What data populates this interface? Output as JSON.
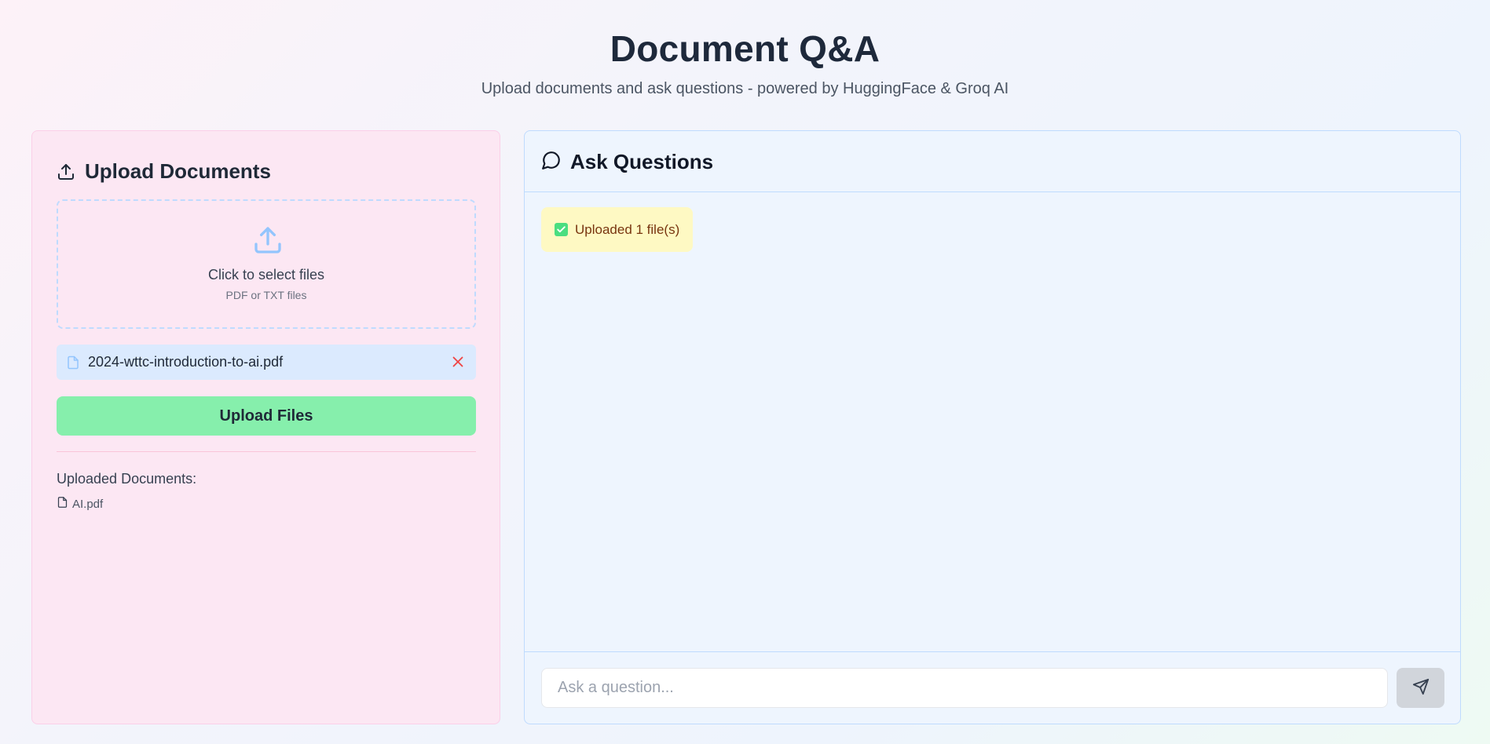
{
  "header": {
    "title": "Document Q&A",
    "subtitle": "Upload documents and ask questions - powered by HuggingFace & Groq AI"
  },
  "upload_panel": {
    "heading": "Upload Documents",
    "heading_icon": "upload-icon",
    "dropzone": {
      "icon": "upload-icon",
      "main_text": "Click to select files",
      "sub_text": "PDF or TXT files"
    },
    "selected_files": [
      {
        "name": "2024-wttc-introduction-to-ai.pdf",
        "icon": "file-icon",
        "remove_icon": "close-icon"
      }
    ],
    "upload_button_label": "Upload Files",
    "uploaded_title": "Uploaded Documents:",
    "uploaded_documents": [
      {
        "name": "AI.pdf",
        "icon": "file-icon"
      }
    ]
  },
  "chat_panel": {
    "heading": "Ask Questions",
    "heading_icon": "message-circle-icon",
    "messages": [
      {
        "type": "status",
        "icon": "check-icon",
        "text": "Uploaded 1 file(s)"
      }
    ],
    "input": {
      "placeholder": "Ask a question...",
      "value": ""
    },
    "send_icon": "send-icon"
  },
  "colors": {
    "left_panel_bg": "#fce7f3",
    "right_panel_bg": "#eef5fe",
    "upload_button": "#86efac",
    "file_row_bg": "#dbeafe",
    "status_bg": "#fef9c3",
    "remove_icon": "#ef4444"
  }
}
